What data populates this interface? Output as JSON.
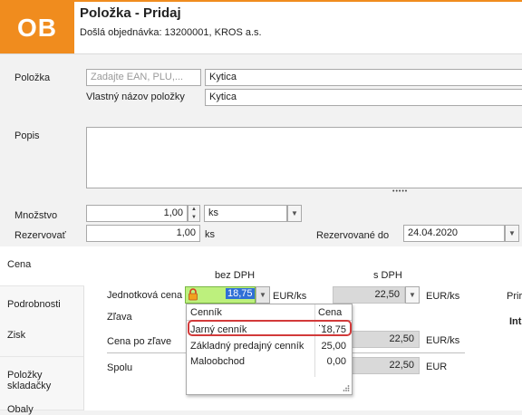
{
  "header": {
    "badge": "OB",
    "title": "Položka - Pridaj",
    "subtitle": "Došlá objednávka: 13200001, KROS a.s."
  },
  "form": {
    "polozka_label": "Položka",
    "ean_placeholder": "Zadajte EAN, PLU,...",
    "polozka_value": "Kytica",
    "vlastny_nazov_label": "Vlastný názov položky",
    "vlastny_nazov_value": "Kytica",
    "popis_label": "Popis",
    "popis_value": "",
    "resize_dots": "•••••",
    "mnozstvo_label": "Množstvo",
    "mnozstvo_value": "1,00",
    "unit_value": "ks",
    "rezervovat_label": "Rezervovať",
    "rezervovat_value": "1,00",
    "rezervovat_unit": "ks",
    "rezervovane_do_label": "Rezervované do",
    "rezervovane_do_value": "24.04.2020"
  },
  "side_tabs": [
    {
      "label": "Cena"
    },
    {
      "label": "Podrobnosti"
    },
    {
      "label": "Zisk"
    },
    {
      "label": "Položky skladačky"
    },
    {
      "label": "Obaly"
    }
  ],
  "price": {
    "bez_dph_header": "bez DPH",
    "s_dph_header": "s DPH",
    "jednotkova_cena_label": "Jednotková cena",
    "jednotkova_cena_value": "18,75",
    "unit_label": "EUR/ks",
    "s_dph_value": "22,50",
    "s_dph_unit": "EUR/ks",
    "zlava_label": "Zľava",
    "cena_po_zlave_label": "Cena po zľave",
    "cena_po_zlave_s_dph": "22,50",
    "cena_po_zlave_unit": "EUR/ks",
    "spolu_label": "Spolu",
    "spolu_s_dph": "22,50",
    "spolu_unit": "EUR",
    "right_cut_1": "Prira",
    "right_cut_2": "Int"
  },
  "popup": {
    "col1": "Cenník",
    "col2": "Cena ...",
    "rows": [
      {
        "name": "Jarný cenník",
        "price": "18,75"
      },
      {
        "name": "Základný predajný cenník",
        "price": "25,00"
      },
      {
        "name": "Maloobchod",
        "price": "0,00"
      }
    ]
  },
  "colors": {
    "accent": "#f08c1e",
    "price_green": "#bdf07d",
    "highlight_red": "#d23a3a",
    "selection_blue": "#2f6fd6"
  }
}
